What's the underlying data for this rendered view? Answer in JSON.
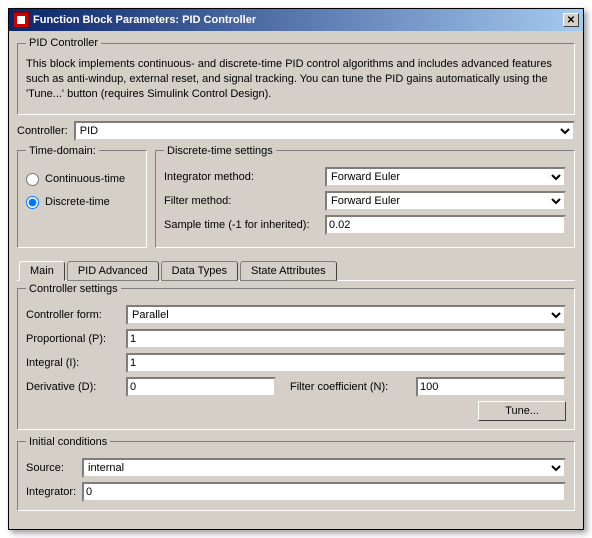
{
  "title": "Function Block Parameters: PID Controller",
  "pid_group": {
    "legend": "PID Controller",
    "description": "This block implements continuous- and discrete-time PID control algorithms and includes advanced features such as anti-windup, external reset, and signal tracking. You can tune the PID gains automatically using the 'Tune...' button (requires Simulink Control Design).",
    "controller_label": "Controller:",
    "controller_value": "PID"
  },
  "time_domain": {
    "legend": "Time-domain:",
    "continuous": "Continuous-time",
    "discrete": "Discrete-time"
  },
  "discrete_settings": {
    "legend": "Discrete-time settings",
    "integrator_label": "Integrator method:",
    "integrator_value": "Forward Euler",
    "filter_label": "Filter method:",
    "filter_value": "Forward Euler",
    "sample_label": "Sample time (-1 for inherited):",
    "sample_value": "0.02"
  },
  "tabs": {
    "main": "Main",
    "advanced": "PID Advanced",
    "datatypes": "Data Types",
    "state": "State Attributes"
  },
  "controller_settings": {
    "legend": "Controller settings",
    "form_label": "Controller form:",
    "form_value": "Parallel",
    "p_label": "Proportional (P):",
    "p_value": "1",
    "i_label": "Integral (I):",
    "i_value": "1",
    "d_label": "Derivative (D):",
    "d_value": "0",
    "n_label": "Filter coefficient (N):",
    "n_value": "100",
    "tune_button": "Tune..."
  },
  "initial_conditions": {
    "legend": "Initial conditions",
    "source_label": "Source:",
    "source_value": "internal",
    "integrator_label": "Integrator:",
    "integrator_value": "0"
  }
}
